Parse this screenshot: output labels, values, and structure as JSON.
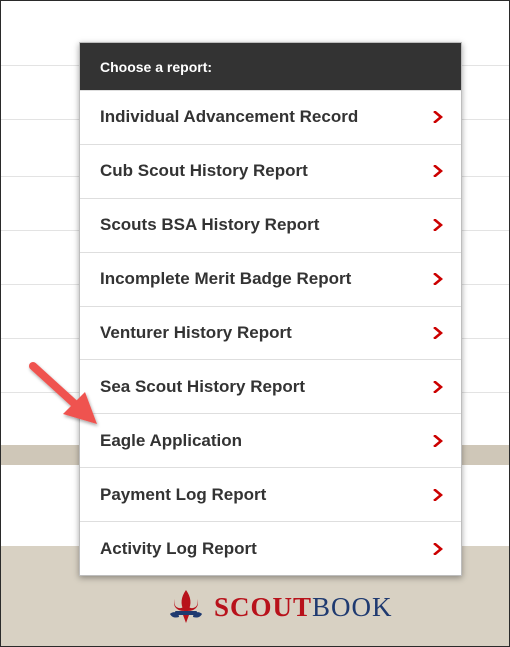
{
  "menu": {
    "header": "Choose a report:",
    "items": [
      {
        "label": "Individual Advancement Record"
      },
      {
        "label": "Cub Scout History Report"
      },
      {
        "label": "Scouts BSA History Report"
      },
      {
        "label": "Incomplete Merit Badge Report"
      },
      {
        "label": "Venturer History Report"
      },
      {
        "label": "Sea Scout History Report"
      },
      {
        "label": "Eagle Application"
      },
      {
        "label": "Payment Log Report"
      },
      {
        "label": "Activity Log Report"
      }
    ]
  },
  "footer": {
    "brand_bold": "SCOUT",
    "brand_light": "BOOK",
    "brand_colors": {
      "red": "#b8121b",
      "blue": "#1f3a70"
    }
  },
  "colors": {
    "header_bg": "#333333",
    "chevron": "#cc0000",
    "annotation_arrow": "#ef5350",
    "footer_band": "#d8d1c3"
  },
  "icons": {
    "chevron": "chevron-right-icon",
    "logo": "fleur-de-lis-icon",
    "annotation": "arrow-annotation-icon"
  }
}
